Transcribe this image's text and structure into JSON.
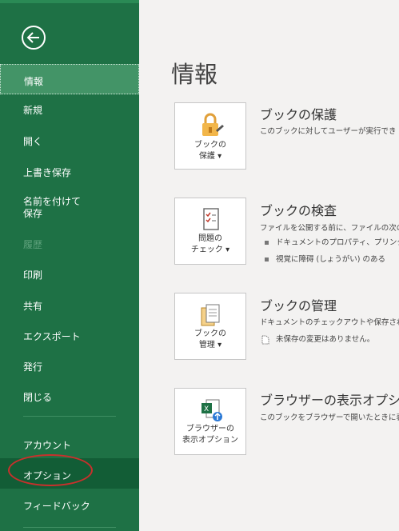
{
  "sidebar": {
    "items": [
      {
        "label": "情報"
      },
      {
        "label": "新規"
      },
      {
        "label": "開く"
      },
      {
        "label": "上書き保存"
      },
      {
        "label_line1": "名前を付けて",
        "label_line2": "保存"
      },
      {
        "label": "履歴"
      },
      {
        "label": "印刷"
      },
      {
        "label": "共有"
      },
      {
        "label": "エクスポート"
      },
      {
        "label": "発行"
      },
      {
        "label": "閉じる"
      },
      {
        "label": "アカウント"
      },
      {
        "label": "オプション"
      },
      {
        "label": "フィードバック"
      }
    ]
  },
  "main": {
    "title": "情報",
    "sections": [
      {
        "tile_line1": "ブックの",
        "tile_line2": "保護",
        "title": "ブックの保護",
        "desc": "このブックに対してユーザーが実行でき"
      },
      {
        "tile_line1": "問題の",
        "tile_line2": "チェック",
        "title": "ブックの検査",
        "desc": "ファイルを公開する前に、ファイルの次の",
        "bullets": [
          "ドキュメントのプロパティ、プリンター",
          "視覚に障碍 (しょうがい) のある"
        ]
      },
      {
        "tile_line1": "ブックの",
        "tile_line2": "管理",
        "title": "ブックの管理",
        "desc": "ドキュメントのチェックアウトや保存されて",
        "note": "未保存の変更はありません。"
      },
      {
        "tile_line1": "ブラウザーの",
        "tile_line2": "表示オプション",
        "title": "ブラウザーの表示オプシ",
        "desc": "このブックをブラウザーで開いたときに表"
      }
    ]
  },
  "colors": {
    "sidebar": "#1e7145",
    "active": "#439467",
    "options_bg": "#125d36",
    "annotation": "#c9302c"
  }
}
